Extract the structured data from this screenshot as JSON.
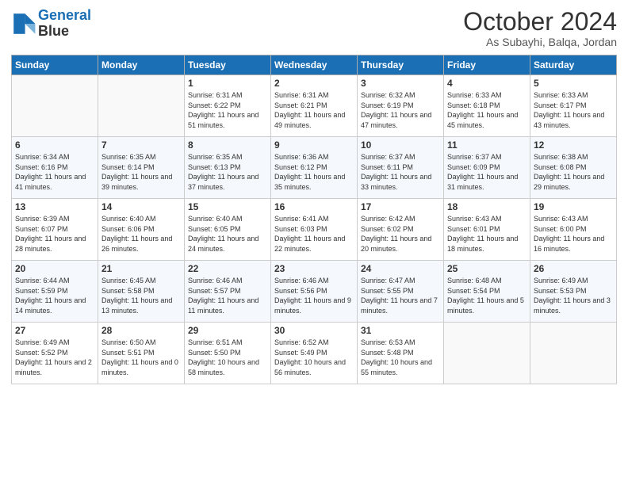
{
  "header": {
    "logo_line1": "General",
    "logo_line2": "Blue",
    "month": "October 2024",
    "location": "As Subayhi, Balqa, Jordan"
  },
  "weekdays": [
    "Sunday",
    "Monday",
    "Tuesday",
    "Wednesday",
    "Thursday",
    "Friday",
    "Saturday"
  ],
  "weeks": [
    [
      {
        "day": "",
        "sunrise": "",
        "sunset": "",
        "daylight": ""
      },
      {
        "day": "",
        "sunrise": "",
        "sunset": "",
        "daylight": ""
      },
      {
        "day": "1",
        "sunrise": "Sunrise: 6:31 AM",
        "sunset": "Sunset: 6:22 PM",
        "daylight": "Daylight: 11 hours and 51 minutes."
      },
      {
        "day": "2",
        "sunrise": "Sunrise: 6:31 AM",
        "sunset": "Sunset: 6:21 PM",
        "daylight": "Daylight: 11 hours and 49 minutes."
      },
      {
        "day": "3",
        "sunrise": "Sunrise: 6:32 AM",
        "sunset": "Sunset: 6:19 PM",
        "daylight": "Daylight: 11 hours and 47 minutes."
      },
      {
        "day": "4",
        "sunrise": "Sunrise: 6:33 AM",
        "sunset": "Sunset: 6:18 PM",
        "daylight": "Daylight: 11 hours and 45 minutes."
      },
      {
        "day": "5",
        "sunrise": "Sunrise: 6:33 AM",
        "sunset": "Sunset: 6:17 PM",
        "daylight": "Daylight: 11 hours and 43 minutes."
      }
    ],
    [
      {
        "day": "6",
        "sunrise": "Sunrise: 6:34 AM",
        "sunset": "Sunset: 6:16 PM",
        "daylight": "Daylight: 11 hours and 41 minutes."
      },
      {
        "day": "7",
        "sunrise": "Sunrise: 6:35 AM",
        "sunset": "Sunset: 6:14 PM",
        "daylight": "Daylight: 11 hours and 39 minutes."
      },
      {
        "day": "8",
        "sunrise": "Sunrise: 6:35 AM",
        "sunset": "Sunset: 6:13 PM",
        "daylight": "Daylight: 11 hours and 37 minutes."
      },
      {
        "day": "9",
        "sunrise": "Sunrise: 6:36 AM",
        "sunset": "Sunset: 6:12 PM",
        "daylight": "Daylight: 11 hours and 35 minutes."
      },
      {
        "day": "10",
        "sunrise": "Sunrise: 6:37 AM",
        "sunset": "Sunset: 6:11 PM",
        "daylight": "Daylight: 11 hours and 33 minutes."
      },
      {
        "day": "11",
        "sunrise": "Sunrise: 6:37 AM",
        "sunset": "Sunset: 6:09 PM",
        "daylight": "Daylight: 11 hours and 31 minutes."
      },
      {
        "day": "12",
        "sunrise": "Sunrise: 6:38 AM",
        "sunset": "Sunset: 6:08 PM",
        "daylight": "Daylight: 11 hours and 29 minutes."
      }
    ],
    [
      {
        "day": "13",
        "sunrise": "Sunrise: 6:39 AM",
        "sunset": "Sunset: 6:07 PM",
        "daylight": "Daylight: 11 hours and 28 minutes."
      },
      {
        "day": "14",
        "sunrise": "Sunrise: 6:40 AM",
        "sunset": "Sunset: 6:06 PM",
        "daylight": "Daylight: 11 hours and 26 minutes."
      },
      {
        "day": "15",
        "sunrise": "Sunrise: 6:40 AM",
        "sunset": "Sunset: 6:05 PM",
        "daylight": "Daylight: 11 hours and 24 minutes."
      },
      {
        "day": "16",
        "sunrise": "Sunrise: 6:41 AM",
        "sunset": "Sunset: 6:03 PM",
        "daylight": "Daylight: 11 hours and 22 minutes."
      },
      {
        "day": "17",
        "sunrise": "Sunrise: 6:42 AM",
        "sunset": "Sunset: 6:02 PM",
        "daylight": "Daylight: 11 hours and 20 minutes."
      },
      {
        "day": "18",
        "sunrise": "Sunrise: 6:43 AM",
        "sunset": "Sunset: 6:01 PM",
        "daylight": "Daylight: 11 hours and 18 minutes."
      },
      {
        "day": "19",
        "sunrise": "Sunrise: 6:43 AM",
        "sunset": "Sunset: 6:00 PM",
        "daylight": "Daylight: 11 hours and 16 minutes."
      }
    ],
    [
      {
        "day": "20",
        "sunrise": "Sunrise: 6:44 AM",
        "sunset": "Sunset: 5:59 PM",
        "daylight": "Daylight: 11 hours and 14 minutes."
      },
      {
        "day": "21",
        "sunrise": "Sunrise: 6:45 AM",
        "sunset": "Sunset: 5:58 PM",
        "daylight": "Daylight: 11 hours and 13 minutes."
      },
      {
        "day": "22",
        "sunrise": "Sunrise: 6:46 AM",
        "sunset": "Sunset: 5:57 PM",
        "daylight": "Daylight: 11 hours and 11 minutes."
      },
      {
        "day": "23",
        "sunrise": "Sunrise: 6:46 AM",
        "sunset": "Sunset: 5:56 PM",
        "daylight": "Daylight: 11 hours and 9 minutes."
      },
      {
        "day": "24",
        "sunrise": "Sunrise: 6:47 AM",
        "sunset": "Sunset: 5:55 PM",
        "daylight": "Daylight: 11 hours and 7 minutes."
      },
      {
        "day": "25",
        "sunrise": "Sunrise: 6:48 AM",
        "sunset": "Sunset: 5:54 PM",
        "daylight": "Daylight: 11 hours and 5 minutes."
      },
      {
        "day": "26",
        "sunrise": "Sunrise: 6:49 AM",
        "sunset": "Sunset: 5:53 PM",
        "daylight": "Daylight: 11 hours and 3 minutes."
      }
    ],
    [
      {
        "day": "27",
        "sunrise": "Sunrise: 6:49 AM",
        "sunset": "Sunset: 5:52 PM",
        "daylight": "Daylight: 11 hours and 2 minutes."
      },
      {
        "day": "28",
        "sunrise": "Sunrise: 6:50 AM",
        "sunset": "Sunset: 5:51 PM",
        "daylight": "Daylight: 11 hours and 0 minutes."
      },
      {
        "day": "29",
        "sunrise": "Sunrise: 6:51 AM",
        "sunset": "Sunset: 5:50 PM",
        "daylight": "Daylight: 10 hours and 58 minutes."
      },
      {
        "day": "30",
        "sunrise": "Sunrise: 6:52 AM",
        "sunset": "Sunset: 5:49 PM",
        "daylight": "Daylight: 10 hours and 56 minutes."
      },
      {
        "day": "31",
        "sunrise": "Sunrise: 6:53 AM",
        "sunset": "Sunset: 5:48 PM",
        "daylight": "Daylight: 10 hours and 55 minutes."
      },
      {
        "day": "",
        "sunrise": "",
        "sunset": "",
        "daylight": ""
      },
      {
        "day": "",
        "sunrise": "",
        "sunset": "",
        "daylight": ""
      }
    ]
  ]
}
